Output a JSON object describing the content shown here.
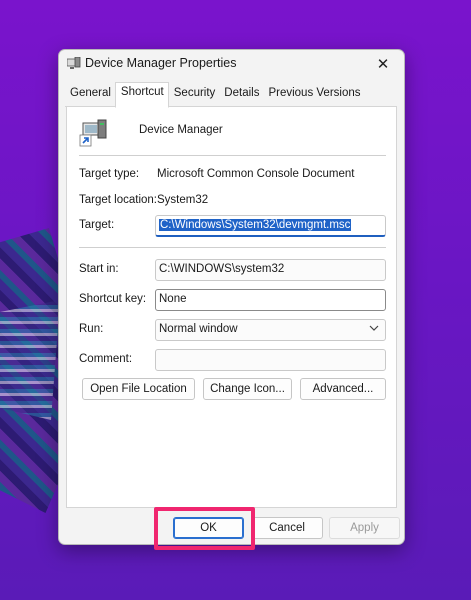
{
  "window": {
    "title": "Device Manager Properties",
    "close_glyph": "✕"
  },
  "tabs": [
    {
      "label": "General",
      "active": false
    },
    {
      "label": "Shortcut",
      "active": true
    },
    {
      "label": "Security",
      "active": false
    },
    {
      "label": "Details",
      "active": false
    },
    {
      "label": "Previous Versions",
      "active": false
    }
  ],
  "shortcut": {
    "app_name": "Device Manager",
    "target_type_label": "Target type:",
    "target_type_value": "Microsoft Common Console Document",
    "target_location_label": "Target location:",
    "target_location_value": "System32",
    "target_label": "Target:",
    "target_value": "C:\\Windows\\System32\\devmgmt.msc",
    "start_in_label": "Start in:",
    "start_in_value": "C:\\WINDOWS\\system32",
    "shortcut_key_label": "Shortcut key:",
    "shortcut_key_value": "None",
    "run_label": "Run:",
    "run_value": "Normal window",
    "comment_label": "Comment:",
    "comment_value": "",
    "open_file_location_label": "Open File Location",
    "change_icon_label": "Change Icon...",
    "advanced_label": "Advanced..."
  },
  "footer": {
    "ok_label": "OK",
    "cancel_label": "Cancel",
    "apply_label": "Apply"
  },
  "colors": {
    "highlight": "#f0266f",
    "selection": "#1f63c8",
    "background": "#6a16c4"
  }
}
